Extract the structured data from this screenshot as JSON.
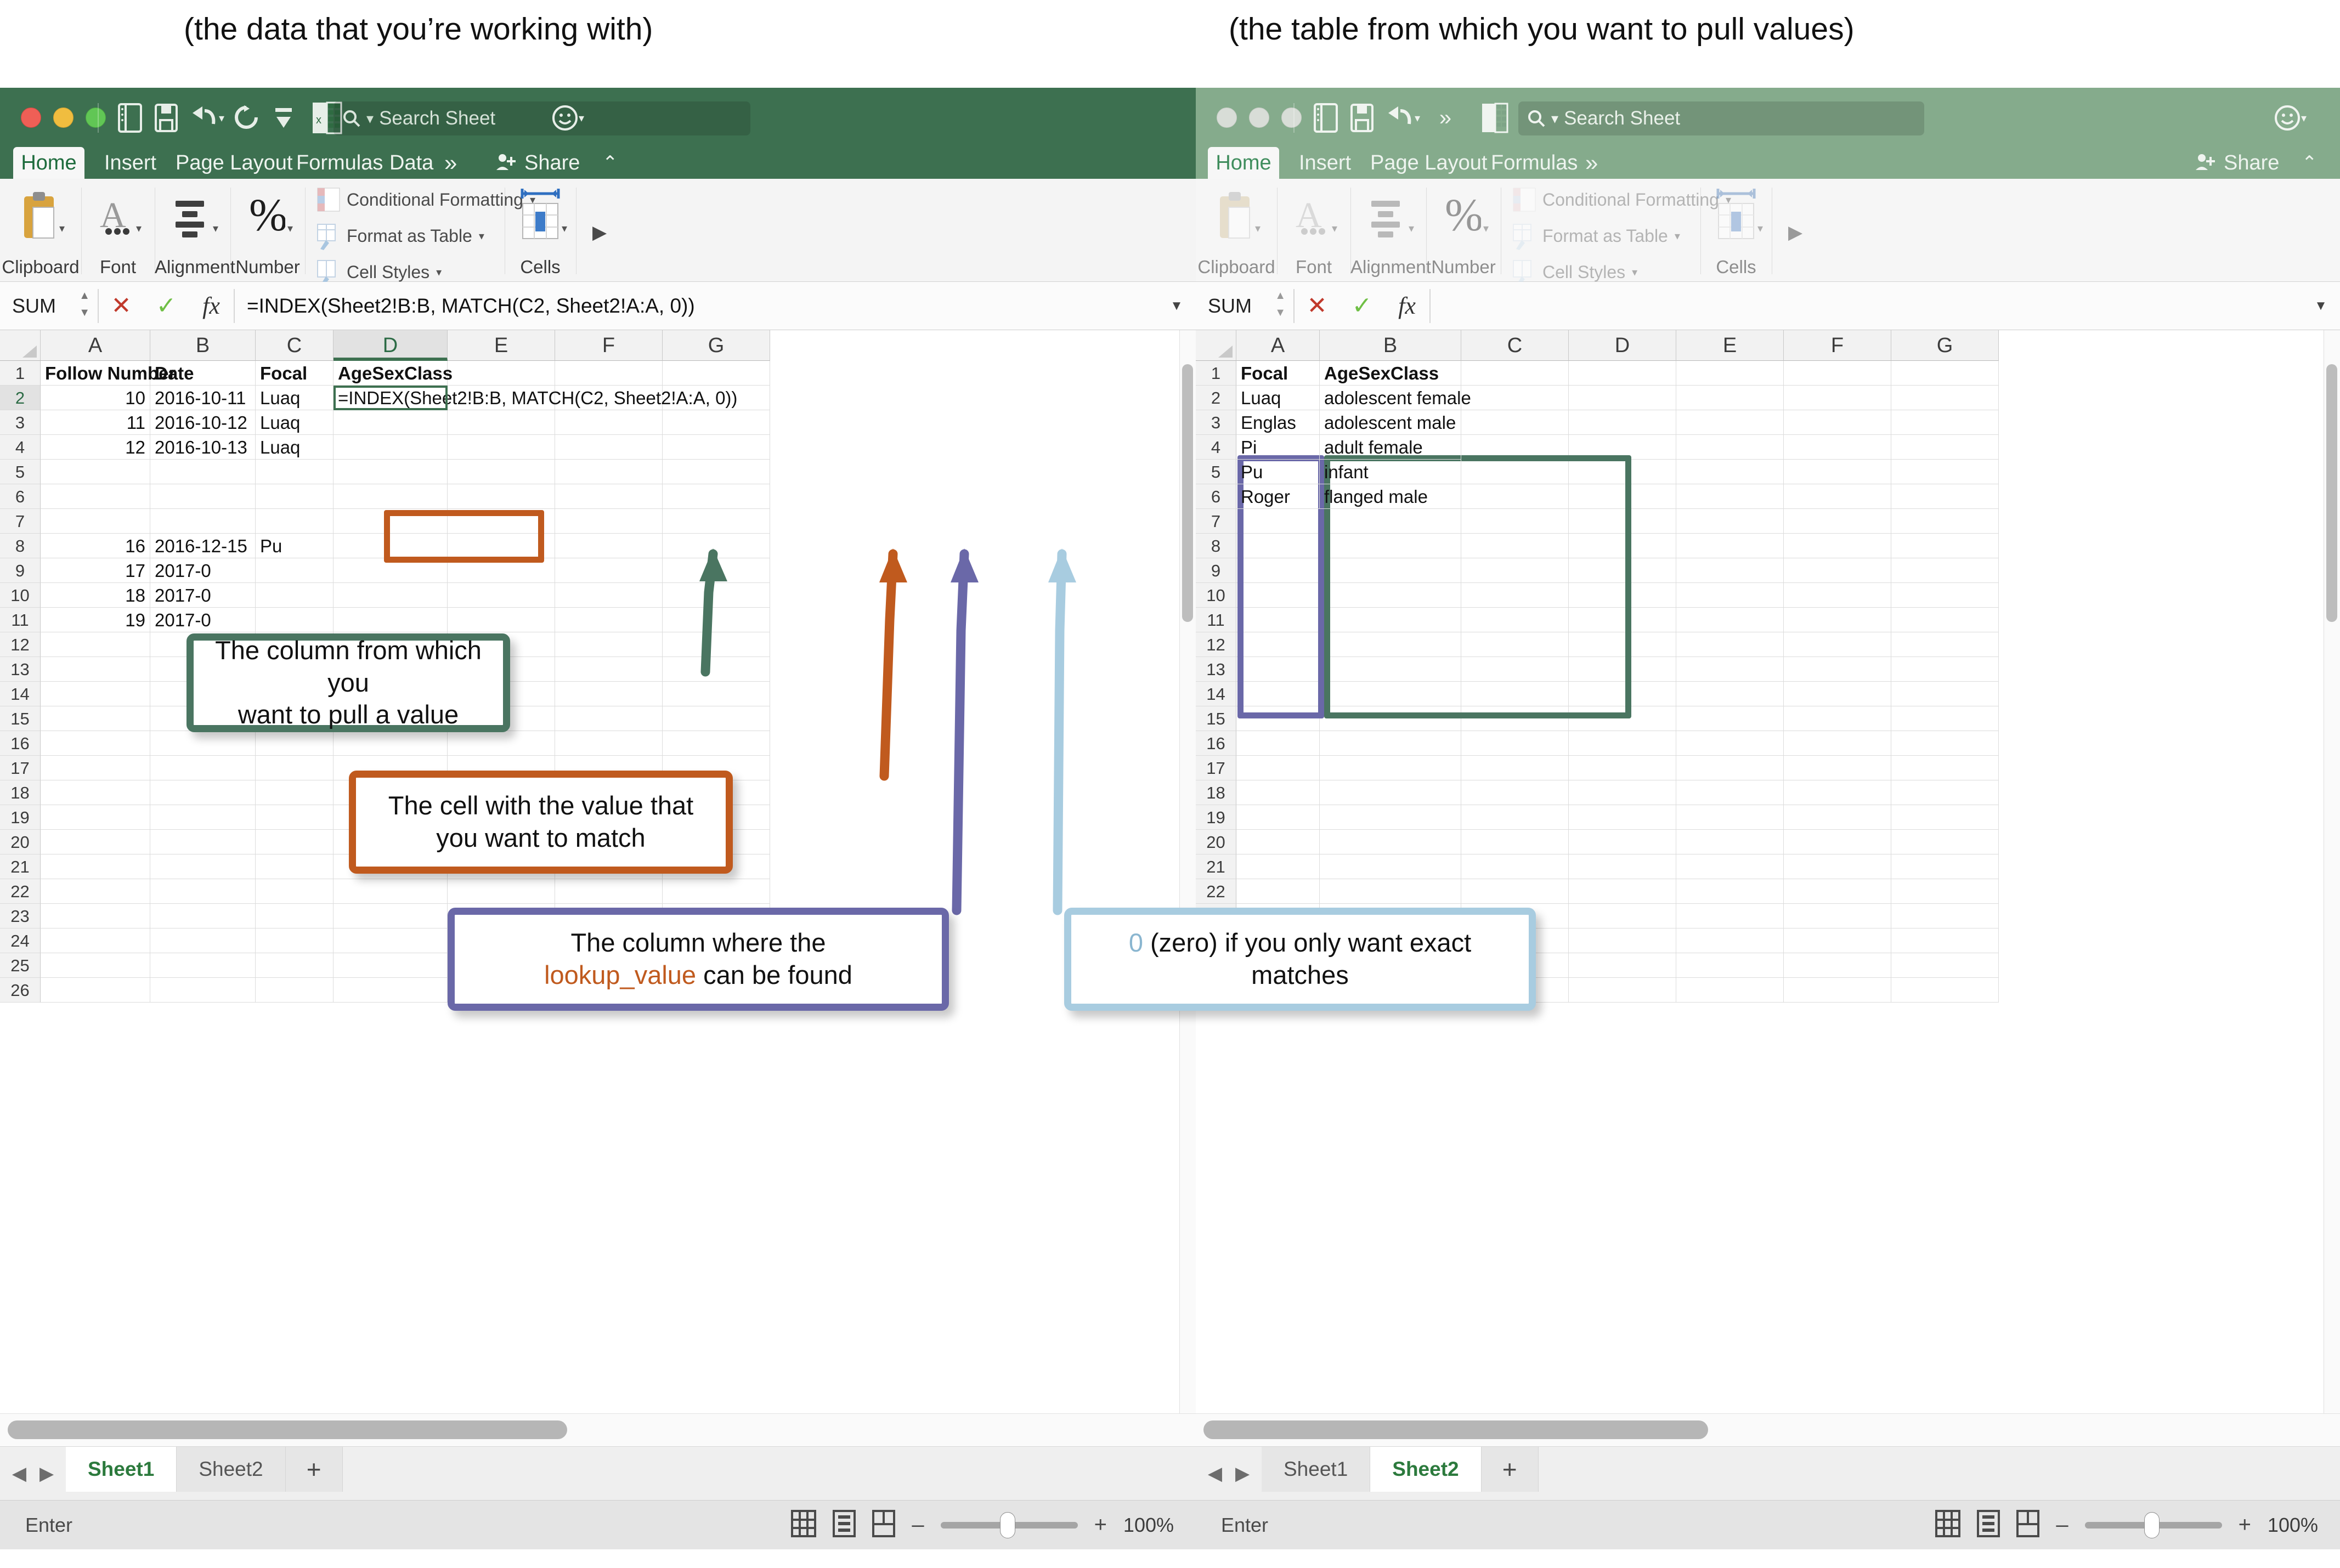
{
  "captions": {
    "left": "(the data that you’re working with)",
    "right": "(the table from which you want to pull values)"
  },
  "colors": {
    "green": "#4a7561",
    "orange": "#c05a1e",
    "purple": "#6a68a8",
    "lightblue": "#a8cce0",
    "ribbon_active": "#3d7050",
    "ribbon_inactive": "#85ab8c"
  },
  "left_window": {
    "search": {
      "placeholder": "Search Sheet"
    },
    "ribbon_tabs": [
      {
        "label": "Home",
        "active": true
      },
      {
        "label": "Insert",
        "active": false
      },
      {
        "label": "Page Layout",
        "active": false
      },
      {
        "label": "Formulas",
        "active": false
      },
      {
        "label": "Data",
        "active": false
      },
      {
        "label": "»",
        "active": false
      }
    ],
    "share_label": "Share",
    "ribbon_groups": [
      {
        "label": "Clipboard"
      },
      {
        "label": "Font"
      },
      {
        "label": "Alignment"
      },
      {
        "label": "Number"
      },
      {
        "label": "Cells"
      }
    ],
    "ribbon_commands": [
      {
        "label": "Conditional Formatting"
      },
      {
        "label": "Format as Table"
      },
      {
        "label": "Cell Styles"
      }
    ],
    "formula_bar": {
      "name_box": "SUM",
      "cancel_icon": "✕",
      "confirm_icon": "✓",
      "fx_icon": "fx",
      "formula": "=INDEX(Sheet2!B:B, MATCH(C2, Sheet2!A:A, 0))"
    },
    "columns": [
      "A",
      "B",
      "C",
      "D",
      "E",
      "F",
      "G"
    ],
    "selected_column": "D",
    "rows": [
      "1",
      "2",
      "3",
      "4",
      "5",
      "6",
      "7",
      "8",
      "9",
      "10",
      "11",
      "12",
      "13",
      "14",
      "15",
      "16",
      "17",
      "18",
      "19",
      "20",
      "21",
      "22",
      "23",
      "24",
      "25",
      "26"
    ],
    "selected_row": "2",
    "cells": [
      {
        "row": 1,
        "A": "Follow Number",
        "B": "Date",
        "C": "Focal",
        "D": "AgeSexClass",
        "bold": true
      },
      {
        "row": 2,
        "A": "10",
        "B": "2016-10-11",
        "C": "Luaq",
        "D": "=INDEX(Sheet2!B:B, MATCH(C2, Sheet2!A:A, 0))"
      },
      {
        "row": 3,
        "A": "11",
        "B": "2016-10-12",
        "C": "Luaq",
        "D": ""
      },
      {
        "row": 4,
        "A": "12",
        "B": "2016-10-13",
        "C": "Luaq",
        "D": ""
      },
      {
        "row": 8,
        "A": "16",
        "B": "2016-12-15",
        "C": "Pu",
        "D": ""
      },
      {
        "row": 9,
        "A": "17",
        "B": "2017-0",
        "C": "",
        "D": ""
      },
      {
        "row": 10,
        "A": "18",
        "B": "2017-0",
        "C": "",
        "D": ""
      },
      {
        "row": 11,
        "A": "19",
        "B": "2017-0",
        "C": "",
        "D": ""
      }
    ],
    "sheet_tabs": [
      {
        "label": "Sheet1",
        "active": true
      },
      {
        "label": "Sheet2",
        "active": false
      }
    ],
    "add_sheet_icon": "+",
    "status": "Enter",
    "zoom": "100%"
  },
  "right_window": {
    "search": {
      "placeholder": "Search Sheet"
    },
    "ribbon_tabs": [
      {
        "label": "Home",
        "active": true
      },
      {
        "label": "Insert",
        "active": false
      },
      {
        "label": "Page Layout",
        "active": false
      },
      {
        "label": "Formulas",
        "active": false
      },
      {
        "label": "»",
        "active": false
      }
    ],
    "share_label": "Share",
    "ribbon_groups": [
      {
        "label": "Clipboard"
      },
      {
        "label": "Font"
      },
      {
        "label": "Alignment"
      },
      {
        "label": "Number"
      },
      {
        "label": "Cells"
      }
    ],
    "ribbon_commands": [
      {
        "label": "Conditional Formatting"
      },
      {
        "label": "Format as Table"
      },
      {
        "label": "Cell Styles"
      }
    ],
    "formula_bar": {
      "name_box": "SUM",
      "cancel_icon": "✕",
      "confirm_icon": "✓",
      "fx_icon": "fx",
      "formula": ""
    },
    "columns": [
      "A",
      "B",
      "C",
      "D",
      "E",
      "F",
      "G"
    ],
    "rows": [
      "1",
      "2",
      "3",
      "4",
      "5",
      "6",
      "7",
      "8",
      "9",
      "10",
      "11",
      "12",
      "13",
      "14",
      "15",
      "16",
      "17",
      "18",
      "19",
      "20",
      "21",
      "22",
      "23",
      "24",
      "25",
      "26"
    ],
    "cells": [
      {
        "row": 1,
        "A": "Focal",
        "B": "AgeSexClass",
        "bold": true
      },
      {
        "row": 2,
        "A": "Luaq",
        "B": "adolescent female"
      },
      {
        "row": 3,
        "A": "Englas",
        "B": "adolescent male"
      },
      {
        "row": 4,
        "A": "Pi",
        "B": "adult female"
      },
      {
        "row": 5,
        "A": "Pu",
        "B": "infant"
      },
      {
        "row": 6,
        "A": "Roger",
        "B": "flanged male"
      }
    ],
    "sheet_tabs": [
      {
        "label": "Sheet1",
        "active": false
      },
      {
        "label": "Sheet2",
        "active": true
      }
    ],
    "add_sheet_icon": "+",
    "status": "Enter",
    "zoom": "100%"
  },
  "annotations": {
    "green": {
      "line1": "The column from which you",
      "line2": "want to pull a value"
    },
    "orange": {
      "line1": "The cell with the value that",
      "line2": "you want to match"
    },
    "purple": {
      "pre": "The column where the",
      "token": "lookup_value",
      "post": " can be found"
    },
    "blue": {
      "token": "0",
      "line1": " (zero) if you only want exact",
      "line2": "matches"
    }
  }
}
